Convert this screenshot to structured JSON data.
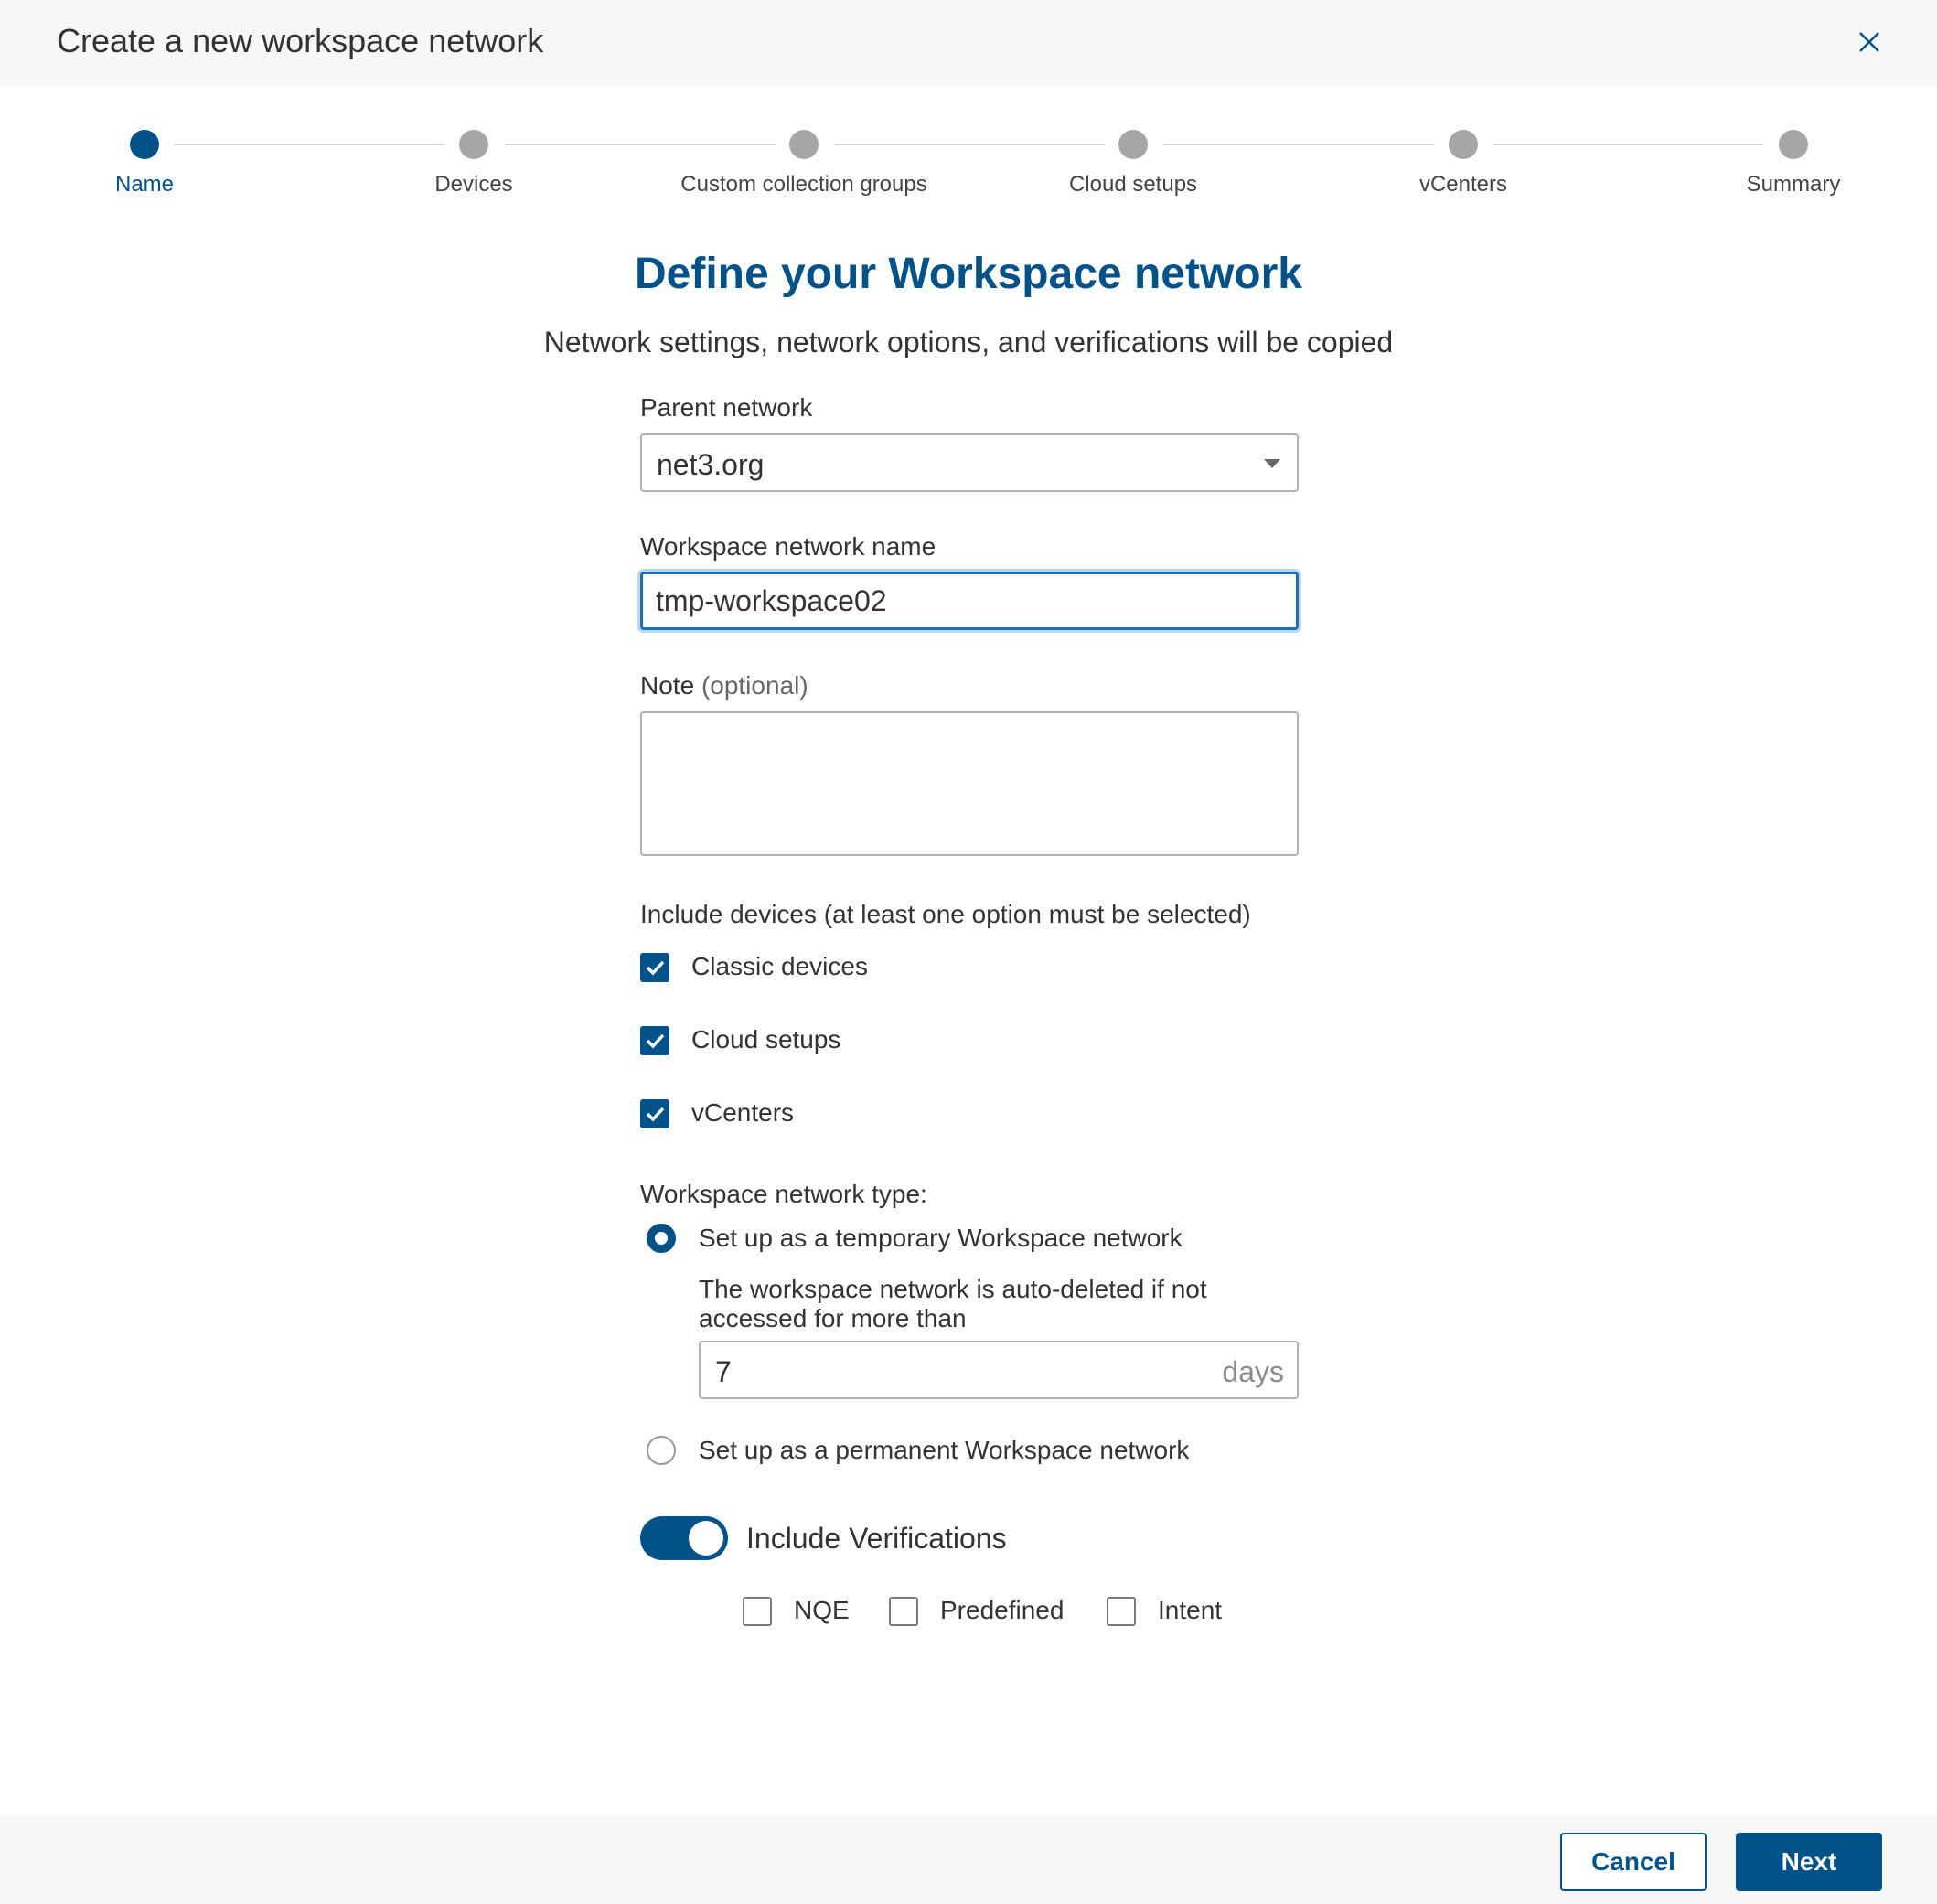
{
  "header": {
    "title": "Create a new workspace network",
    "close_icon": "close-icon"
  },
  "stepper": {
    "steps": [
      {
        "label": "Name",
        "active": true
      },
      {
        "label": "Devices",
        "active": false
      },
      {
        "label": "Custom collection groups",
        "active": false
      },
      {
        "label": "Cloud setups",
        "active": false
      },
      {
        "label": "vCenters",
        "active": false
      },
      {
        "label": "Summary",
        "active": false
      }
    ]
  },
  "main": {
    "title": "Define your Workspace network",
    "subtitle": "Network settings, network options, and verifications will be copied"
  },
  "form": {
    "parent_network": {
      "label": "Parent network",
      "value": "net3.org"
    },
    "workspace_name": {
      "label": "Workspace network name",
      "value": "tmp-workspace02"
    },
    "note": {
      "label": "Note",
      "optional": "(optional)",
      "value": ""
    },
    "include_devices": {
      "label": "Include devices (at least one option must be selected)",
      "options": [
        {
          "label": "Classic devices",
          "checked": true
        },
        {
          "label": "Cloud setups",
          "checked": true
        },
        {
          "label": "vCenters",
          "checked": true
        }
      ]
    },
    "network_type": {
      "label": "Workspace network type:",
      "temporary": {
        "label": "Set up as a temporary Workspace network",
        "checked": true,
        "help": "The workspace network is auto-deleted if not accessed for more than",
        "days_value": "7",
        "days_unit": "days"
      },
      "permanent": {
        "label": "Set up as a permanent Workspace network",
        "checked": false
      }
    },
    "verifications": {
      "label": "Include Verifications",
      "enabled": true,
      "options": [
        {
          "label": "NQE",
          "checked": false
        },
        {
          "label": "Predefined",
          "checked": false
        },
        {
          "label": "Intent",
          "checked": false
        }
      ]
    }
  },
  "footer": {
    "cancel_label": "Cancel",
    "next_label": "Next"
  },
  "colors": {
    "brand": "#005288",
    "inactive_step": "#a6a6a6",
    "focus_border": "#1a73b8"
  }
}
